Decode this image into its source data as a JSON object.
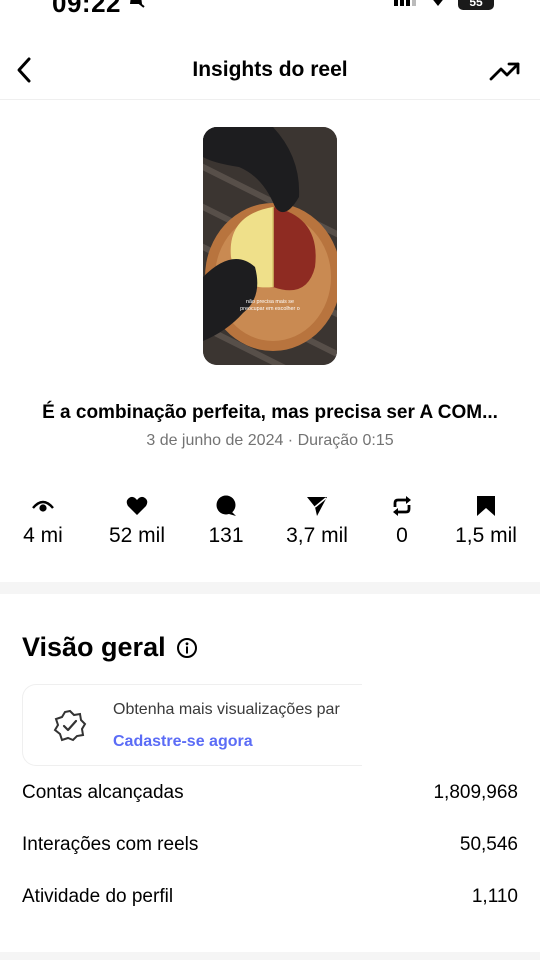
{
  "status_bar": {
    "time": "09:22",
    "battery": "55"
  },
  "header": {
    "title": "Insights do reel"
  },
  "reel": {
    "overlay_text": "não precisa mais se preocupar em escolher o",
    "caption": "É a combinação perfeita, mas precisa ser A COM...",
    "meta": "3 de junho de 2024 · Duração 0:15"
  },
  "metrics": [
    {
      "icon": "eye-icon",
      "value": "4 mi"
    },
    {
      "icon": "heart-icon",
      "value": "52 mil"
    },
    {
      "icon": "comment-icon",
      "value": "131"
    },
    {
      "icon": "share-icon",
      "value": "3,7 mil"
    },
    {
      "icon": "repost-icon",
      "value": "0"
    },
    {
      "icon": "bookmark-icon",
      "value": "1,5 mil"
    }
  ],
  "overview": {
    "title": "Visão geral",
    "promo_text": "Obtenha mais visualizações par",
    "promo_link": "Cadastre-se agora",
    "stats": [
      {
        "label": "Contas alcançadas",
        "value": "1,809,968"
      },
      {
        "label": "Interações com reels",
        "value": "50,546"
      },
      {
        "label": "Atividade do perfil",
        "value": "1,110"
      }
    ]
  }
}
